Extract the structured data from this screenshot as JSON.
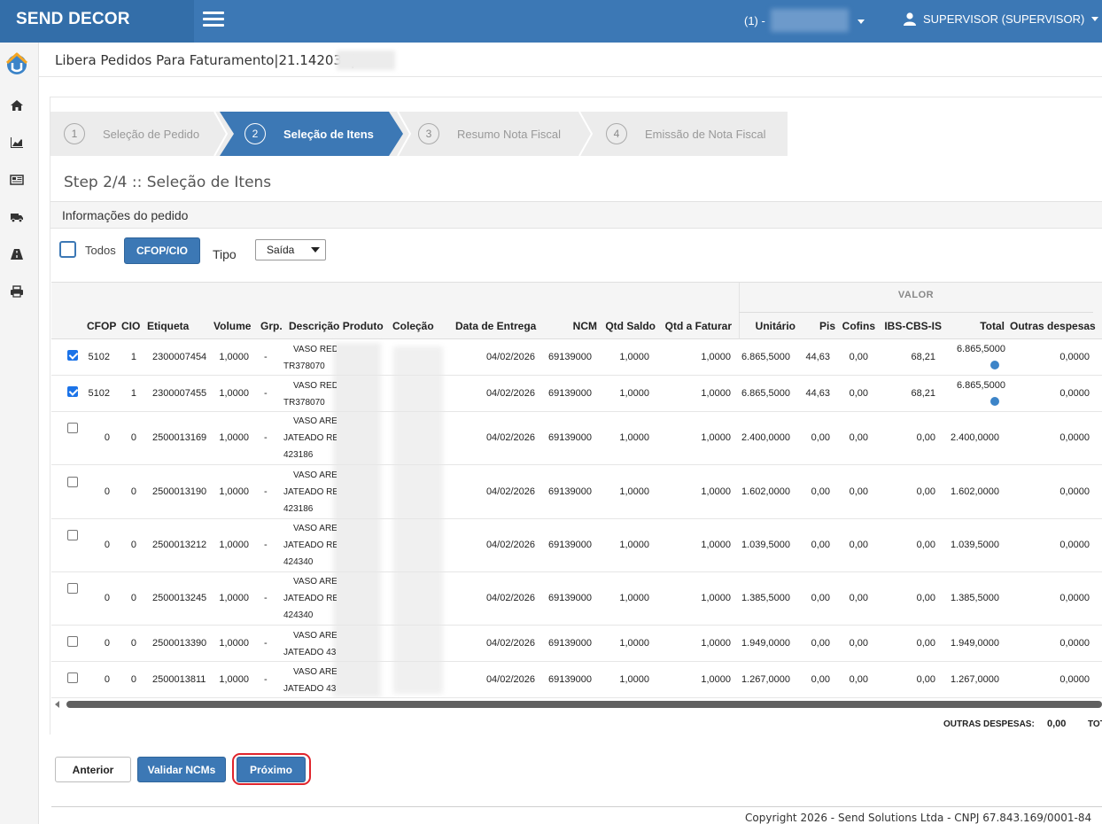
{
  "app": {
    "brand": "SEND DECOR"
  },
  "header": {
    "company": "(1) -",
    "user": "SUPERVISOR (SUPERVISOR)"
  },
  "sidebar": {
    "icons": [
      "home-icon",
      "chart-icon",
      "newspaper-icon",
      "truck-icon",
      "road-icon",
      "print-icon"
    ]
  },
  "page": {
    "title": "Libera Pedidos Para Faturamento|21.142030|"
  },
  "wizard": {
    "steps": [
      {
        "num": "1",
        "label": "Seleção de Pedido"
      },
      {
        "num": "2",
        "label": "Seleção de Itens"
      },
      {
        "num": "3",
        "label": "Resumo Nota Fiscal"
      },
      {
        "num": "4",
        "label": "Emissão de Nota Fiscal"
      }
    ],
    "active_step": 2
  },
  "step_heading": "Step 2/4 :: Seleção de Itens",
  "info_title": "Informações do pedido",
  "filters": {
    "todos_label": "Todos",
    "cfop_button": "CFOP/CIO",
    "tipo_label": "Tipo",
    "tipo_value": "Saída"
  },
  "table": {
    "group_header": "VALOR",
    "columns": [
      "CFOP",
      "CIO",
      "Etiqueta",
      "Volume",
      "Grp.",
      "Descrição Produto",
      "Coleção",
      "Data de Entrega",
      "NCM",
      "Qtd Saldo",
      "Qtd a Faturar",
      "Unitário",
      "Pis",
      "Cofins",
      "IBS-CBS-IS",
      "Total",
      "Outras despesas"
    ],
    "rows": [
      {
        "checked": true,
        "cfop": "5102",
        "cio": "1",
        "etiqueta": "2300007454",
        "volume": "1,0000",
        "grp": "-",
        "desc": [
          "VASO RED",
          "TR378070"
        ],
        "data": "04/02/2026",
        "ncm": "69139000",
        "qtd_saldo": "1,0000",
        "qtd_faturar": "1,0000",
        "unitario": "6.865,5000",
        "pis": "44,63",
        "cofins": "0,00",
        "ibs": "68,21",
        "total": "6.865,5000",
        "total_dot": true,
        "outras": "0,0000"
      },
      {
        "checked": true,
        "cfop": "5102",
        "cio": "1",
        "etiqueta": "2300007455",
        "volume": "1,0000",
        "grp": "-",
        "desc": [
          "VASO RED",
          "TR378070"
        ],
        "data": "04/02/2026",
        "ncm": "69139000",
        "qtd_saldo": "1,0000",
        "qtd_faturar": "1,0000",
        "unitario": "6.865,5000",
        "pis": "44,63",
        "cofins": "0,00",
        "ibs": "68,21",
        "total": "6.865,5000",
        "total_dot": true,
        "outras": "0,0000"
      },
      {
        "checked": false,
        "cfop": "0",
        "cio": "0",
        "etiqueta": "2500013169",
        "volume": "1,0000",
        "grp": "-",
        "desc": [
          "VASO ARE",
          "JATEADO RE",
          "423186"
        ],
        "data": "04/02/2026",
        "ncm": "69139000",
        "qtd_saldo": "1,0000",
        "qtd_faturar": "1,0000",
        "unitario": "2.400,0000",
        "pis": "0,00",
        "cofins": "0,00",
        "ibs": "0,00",
        "total": "2.400,0000",
        "total_dot": false,
        "outras": "0,0000"
      },
      {
        "checked": false,
        "cfop": "0",
        "cio": "0",
        "etiqueta": "2500013190",
        "volume": "1,0000",
        "grp": "-",
        "desc": [
          "VASO ARE",
          "JATEADO RE",
          "423186"
        ],
        "data": "04/02/2026",
        "ncm": "69139000",
        "qtd_saldo": "1,0000",
        "qtd_faturar": "1,0000",
        "unitario": "1.602,0000",
        "pis": "0,00",
        "cofins": "0,00",
        "ibs": "0,00",
        "total": "1.602,0000",
        "total_dot": false,
        "outras": "0,0000"
      },
      {
        "checked": false,
        "cfop": "0",
        "cio": "0",
        "etiqueta": "2500013212",
        "volume": "1,0000",
        "grp": "-",
        "desc": [
          "VASO ARE",
          "JATEADO RE",
          "424340"
        ],
        "data": "04/02/2026",
        "ncm": "69139000",
        "qtd_saldo": "1,0000",
        "qtd_faturar": "1,0000",
        "unitario": "1.039,5000",
        "pis": "0,00",
        "cofins": "0,00",
        "ibs": "0,00",
        "total": "1.039,5000",
        "total_dot": false,
        "outras": "0,0000"
      },
      {
        "checked": false,
        "cfop": "0",
        "cio": "0",
        "etiqueta": "2500013245",
        "volume": "1,0000",
        "grp": "-",
        "desc": [
          "VASO ARE",
          "JATEADO RE",
          "424340"
        ],
        "data": "04/02/2026",
        "ncm": "69139000",
        "qtd_saldo": "1,0000",
        "qtd_faturar": "1,0000",
        "unitario": "1.385,5000",
        "pis": "0,00",
        "cofins": "0,00",
        "ibs": "0,00",
        "total": "1.385,5000",
        "total_dot": false,
        "outras": "0,0000"
      },
      {
        "checked": false,
        "cfop": "0",
        "cio": "0",
        "etiqueta": "2500013390",
        "volume": "1,0000",
        "grp": "-",
        "desc": [
          "VASO ARE",
          "JATEADO 43"
        ],
        "data": "04/02/2026",
        "ncm": "69139000",
        "qtd_saldo": "1,0000",
        "qtd_faturar": "1,0000",
        "unitario": "1.949,0000",
        "pis": "0,00",
        "cofins": "0,00",
        "ibs": "0,00",
        "total": "1.949,0000",
        "total_dot": false,
        "outras": "0,0000"
      },
      {
        "checked": false,
        "cfop": "0",
        "cio": "0",
        "etiqueta": "2500013811",
        "volume": "1,0000",
        "grp": "-",
        "desc": [
          "VASO ARE",
          "JATEADO 43"
        ],
        "data": "04/02/2026",
        "ncm": "69139000",
        "qtd_saldo": "1,0000",
        "qtd_faturar": "1,0000",
        "unitario": "1.267,0000",
        "pis": "0,00",
        "cofins": "0,00",
        "ibs": "0,00",
        "total": "1.267,0000",
        "total_dot": false,
        "outras": "0,0000"
      }
    ]
  },
  "totals": {
    "outras_label": "OUTRAS DESPESAS:",
    "outras_value": "0,00",
    "total_label": "TOT"
  },
  "buttons": {
    "anterior": "Anterior",
    "validar": "Validar NCMs",
    "proximo": "Próximo"
  },
  "footer": {
    "copyright": "Copyright 2026 - Send Solutions Ltda - CNPJ 67.843.169/0001-84"
  },
  "colors": {
    "primary": "#3c78b5",
    "brand_bg": "#336ea9",
    "highlight_ring": "#e0242c"
  }
}
